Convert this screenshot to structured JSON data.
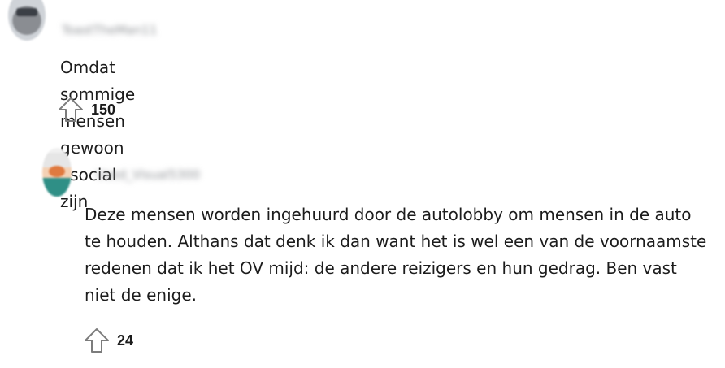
{
  "comments": [
    {
      "username": "ToastTheMan11",
      "text": "Omdat sommige mensen gewoon asocial zijn",
      "upvotes": "150",
      "avatar_icon": "user-avatar-icon"
    },
    {
      "username": "Used_Visual5300",
      "text": "Deze mensen worden ingehuurd door de autolobby om mensen in de auto te houden. Althans dat denk ik dan want het is wel een van de voornaamste redenen dat ik het OV mijd: de andere reizigers en hun gedrag. Ben vast niet de enige.",
      "upvotes": "24",
      "avatar_icon": "user-avatar-icon"
    }
  ],
  "icons": {
    "upvote": "upvote-arrow-icon"
  },
  "colors": {
    "text": "#1c1c1c",
    "icon_stroke": "#7c7c7c",
    "username_blur": "#8f9296"
  }
}
